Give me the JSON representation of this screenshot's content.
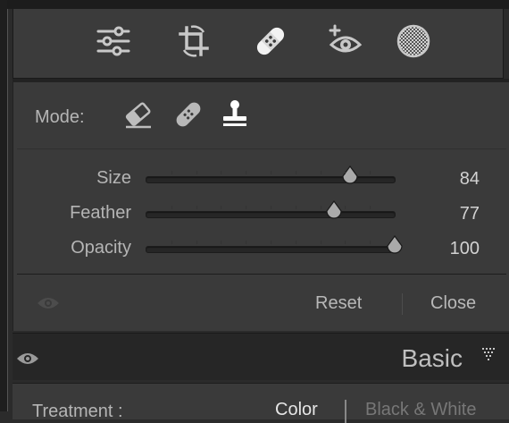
{
  "tools": [
    {
      "name": "edit-sliders-icon"
    },
    {
      "name": "crop-icon"
    },
    {
      "name": "healing-icon"
    },
    {
      "name": "red-eye-icon"
    },
    {
      "name": "masking-icon"
    }
  ],
  "mode": {
    "label": "Mode:",
    "options": [
      {
        "name": "content-aware-remove-icon"
      },
      {
        "name": "heal-icon"
      },
      {
        "name": "clone-icon"
      }
    ],
    "selected": "clone"
  },
  "sliders": {
    "size": {
      "label": "Size",
      "value": "84",
      "fraction": 0.82
    },
    "feather": {
      "label": "Feather",
      "value": "77",
      "fraction": 0.755
    },
    "opacity": {
      "label": "Opacity",
      "value": "100",
      "fraction": 1.0
    }
  },
  "actions": {
    "reset": "Reset",
    "close": "Close"
  },
  "basic": {
    "title": "Basic"
  },
  "treatment": {
    "label": "Treatment :",
    "color": "Color",
    "bw": "Black & White"
  },
  "colors": {
    "accent_selected": "#ffffff",
    "icon": "#c8c8c8",
    "panel": "#3a3a3a"
  }
}
